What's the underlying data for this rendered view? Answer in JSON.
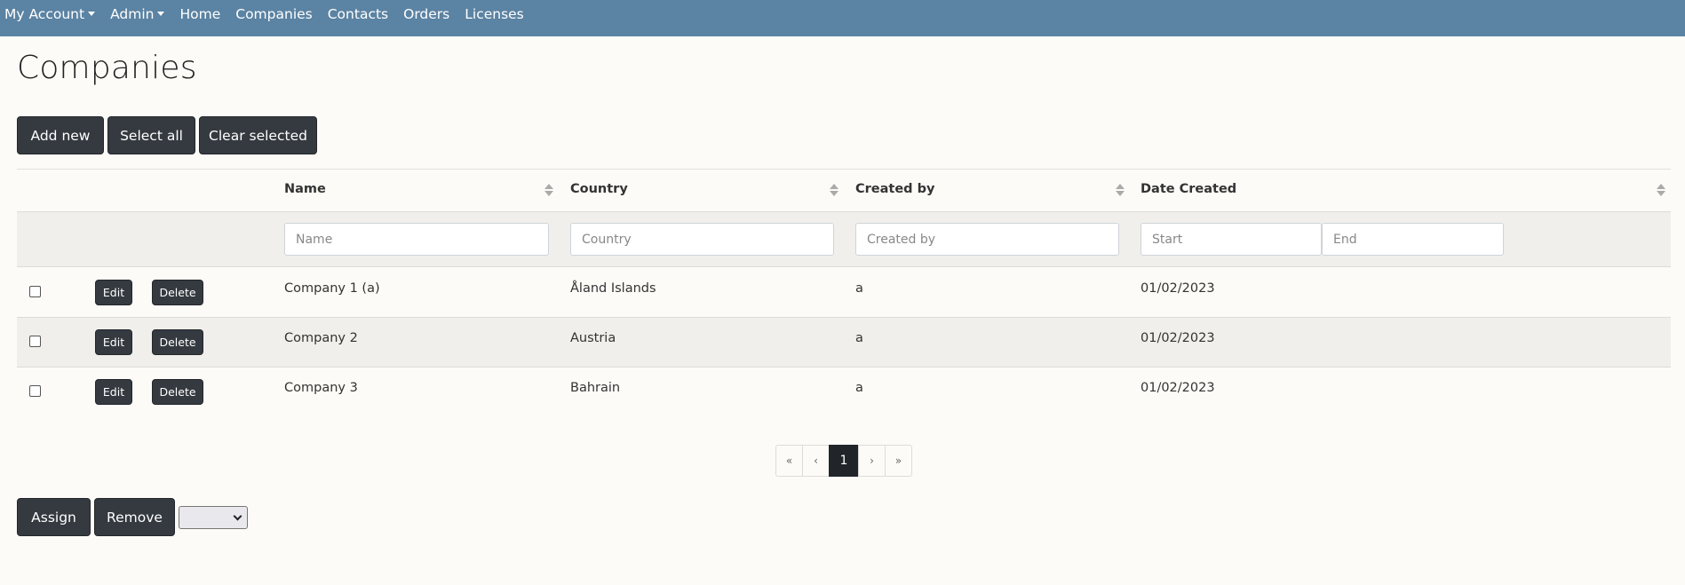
{
  "navbar": {
    "items": [
      {
        "label": "My Account",
        "dropdown": true
      },
      {
        "label": "Admin",
        "dropdown": true
      },
      {
        "label": "Home",
        "dropdown": false
      },
      {
        "label": "Companies",
        "dropdown": false
      },
      {
        "label": "Contacts",
        "dropdown": false
      },
      {
        "label": "Orders",
        "dropdown": false
      },
      {
        "label": "Licenses",
        "dropdown": false
      }
    ]
  },
  "page": {
    "title": "Companies"
  },
  "toolbar": {
    "add_new": "Add new",
    "select_all": "Select all",
    "clear_selected": "Clear selected"
  },
  "table": {
    "columns": [
      "Name",
      "Country",
      "Created by",
      "Date Created"
    ],
    "filters": {
      "name": "Name",
      "country": "Country",
      "created_by": "Created by",
      "start": "Start",
      "end": "End"
    },
    "edit_label": "Edit",
    "delete_label": "Delete",
    "rows": [
      {
        "name": "Company 1 (a)",
        "country": "Åland Islands",
        "created_by": "a",
        "date_created": "01/02/2023"
      },
      {
        "name": "Company 2",
        "country": "Austria",
        "created_by": "a",
        "date_created": "01/02/2023"
      },
      {
        "name": "Company 3",
        "country": "Bahrain",
        "created_by": "a",
        "date_created": "01/02/2023"
      }
    ]
  },
  "pagination": {
    "first": "«",
    "prev": "‹",
    "current": "1",
    "next": "›",
    "last": "»"
  },
  "footer": {
    "assign": "Assign",
    "remove": "Remove",
    "select_value": ""
  },
  "colors": {
    "navbar": "#5b83a3",
    "button": "#343a40",
    "background": "#fcfbf7",
    "stripe": "#f0efeb"
  }
}
